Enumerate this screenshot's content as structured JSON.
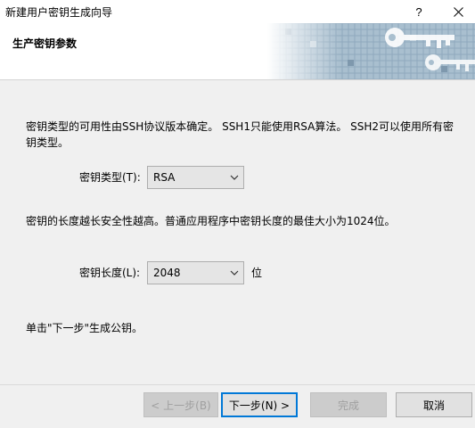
{
  "window": {
    "title": "新建用户密钥生成向导",
    "help_glyph": "?",
    "close_glyph": "✕"
  },
  "header": {
    "title": "生产密钥参数",
    "art_icon": "keys-banner-icon"
  },
  "content": {
    "intro": "密钥类型的可用性由SSH协议版本确定。 SSH1只能使用RSA算法。 SSH2可以使用所有密钥类型。",
    "key_type_label": "密钥类型(T):",
    "key_type_value": "RSA",
    "length_note": "密钥的长度越长安全性越高。普通应用程序中密钥长度的最佳大小为1024位。",
    "key_length_label": "密钥长度(L):",
    "key_length_value": "2048",
    "key_length_unit": "位",
    "next_hint": "单击\"下一步\"生成公钥。"
  },
  "buttons": {
    "back": "< 上一步(B)",
    "next": "下一步(N) >",
    "finish": "完成",
    "cancel": "取消"
  },
  "colors": {
    "window_bg": "#f0f0f0",
    "header_bg": "#ffffff",
    "default_button_border": "#0078d7"
  }
}
